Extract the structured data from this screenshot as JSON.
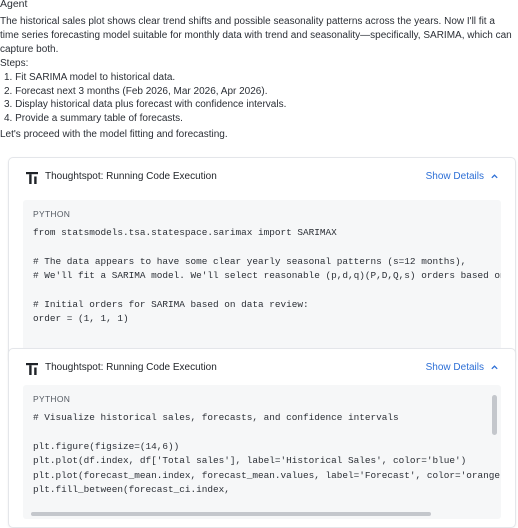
{
  "agent": {
    "label": "Agent",
    "intro": "The historical sales plot shows clear trend shifts and possible seasonality patterns across the years. Now I'll fit a time series forecasting model suitable for monthly data with trend and seasonality—specifically, SARIMA, which can capture both.",
    "steps_label": "Steps:",
    "steps": [
      "1.  Fit SARIMA model to historical data.",
      "2.  Forecast next 3 months (Feb 2026, Mar 2026, Apr 2026).",
      "3.  Display historical data plus forecast with confidence intervals.",
      "4.  Provide a summary table of forecasts."
    ],
    "proceed": "Let's proceed with the model fitting and forecasting."
  },
  "cards": [
    {
      "title": "Thoughtspot: Running Code Execution",
      "show_details": "Show Details",
      "language": "PYTHON",
      "code": "from statsmodels.tsa.statespace.sarimax import SARIMAX\n\n# The data appears to have some clear yearly seasonal patterns (s=12 months),\n# We'll fit a SARIMA model. We'll select reasonable (p,d,q)(P,D,Q,s) orders based on s\n\n# Initial orders for SARIMA based on data review:\norder = (1, 1, 1)"
    },
    {
      "title": "Thoughtspot: Running Code Execution",
      "show_details": "Show Details",
      "language": "PYTHON",
      "code": "# Visualize historical sales, forecasts, and confidence intervals\n\nplt.figure(figsize=(14,6))\nplt.plot(df.index, df['Total sales'], label='Historical Sales', color='blue')\nplt.plot(forecast_mean.index, forecast_mean.values, label='Forecast', color='orange',\nplt.fill_between(forecast_ci.index,"
    }
  ],
  "colors": {
    "link": "#2d6fd6",
    "code_bg": "#f6f7f8"
  },
  "icons": {
    "logo": "thoughtspot-logo-icon",
    "chevron": "chevron-up-icon"
  }
}
